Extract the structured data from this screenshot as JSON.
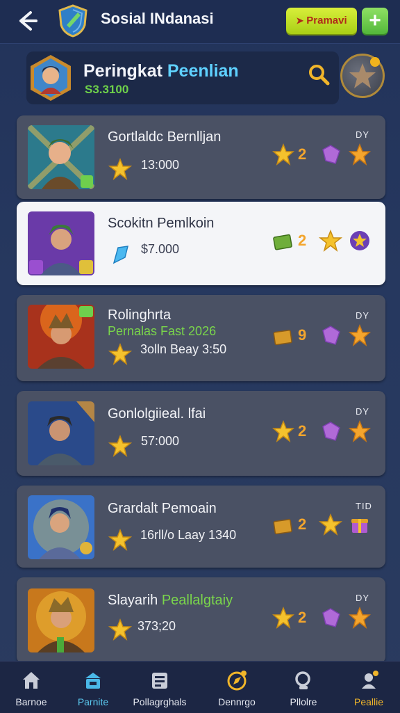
{
  "header": {
    "title": "Sosial INdanasi",
    "premium_label": "Pramavi",
    "add_label": "+"
  },
  "leaderboard": {
    "title_main": "Peringkat ",
    "title_accent": "Peenlian",
    "subtitle": "S3.3100"
  },
  "items": [
    {
      "title": "Gortlaldc Bernlljan",
      "subtitle": "",
      "value": "13:000",
      "tag": "DY",
      "count": "2"
    },
    {
      "title": "Scokitn Pemlkoin",
      "subtitle": "",
      "value": "$7.000",
      "tag": "",
      "count": "2"
    },
    {
      "title": "Rolinghrta",
      "subtitle": "Pernalas Fast 2026",
      "value": "3olln Beay 3:50",
      "tag": "DY",
      "count": "9"
    },
    {
      "title": "Gonlolgiieal. lfai",
      "subtitle": "",
      "value": "57:000",
      "tag": "DY",
      "count": "2"
    },
    {
      "title": "Grardalt Pemoain",
      "subtitle": "",
      "value": "16rll/o Laay 1340",
      "tag": "TID",
      "count": "2"
    },
    {
      "title": "Slayarih ",
      "subtitle": "Peallalgtaiy",
      "value": "373;20",
      "tag": "DY",
      "count": "2"
    }
  ],
  "nav": [
    {
      "label": "Barnoe"
    },
    {
      "label": "Parnite"
    },
    {
      "label": "Pollagrghals"
    },
    {
      "label": "Dennrgo"
    },
    {
      "label": "Pllolre"
    },
    {
      "label": "Peallie"
    }
  ],
  "colors": {
    "accent": "#5fd1ff",
    "premium": "#c9e42c",
    "add": "#6fcf4d",
    "highlight": "#f0b52a"
  }
}
